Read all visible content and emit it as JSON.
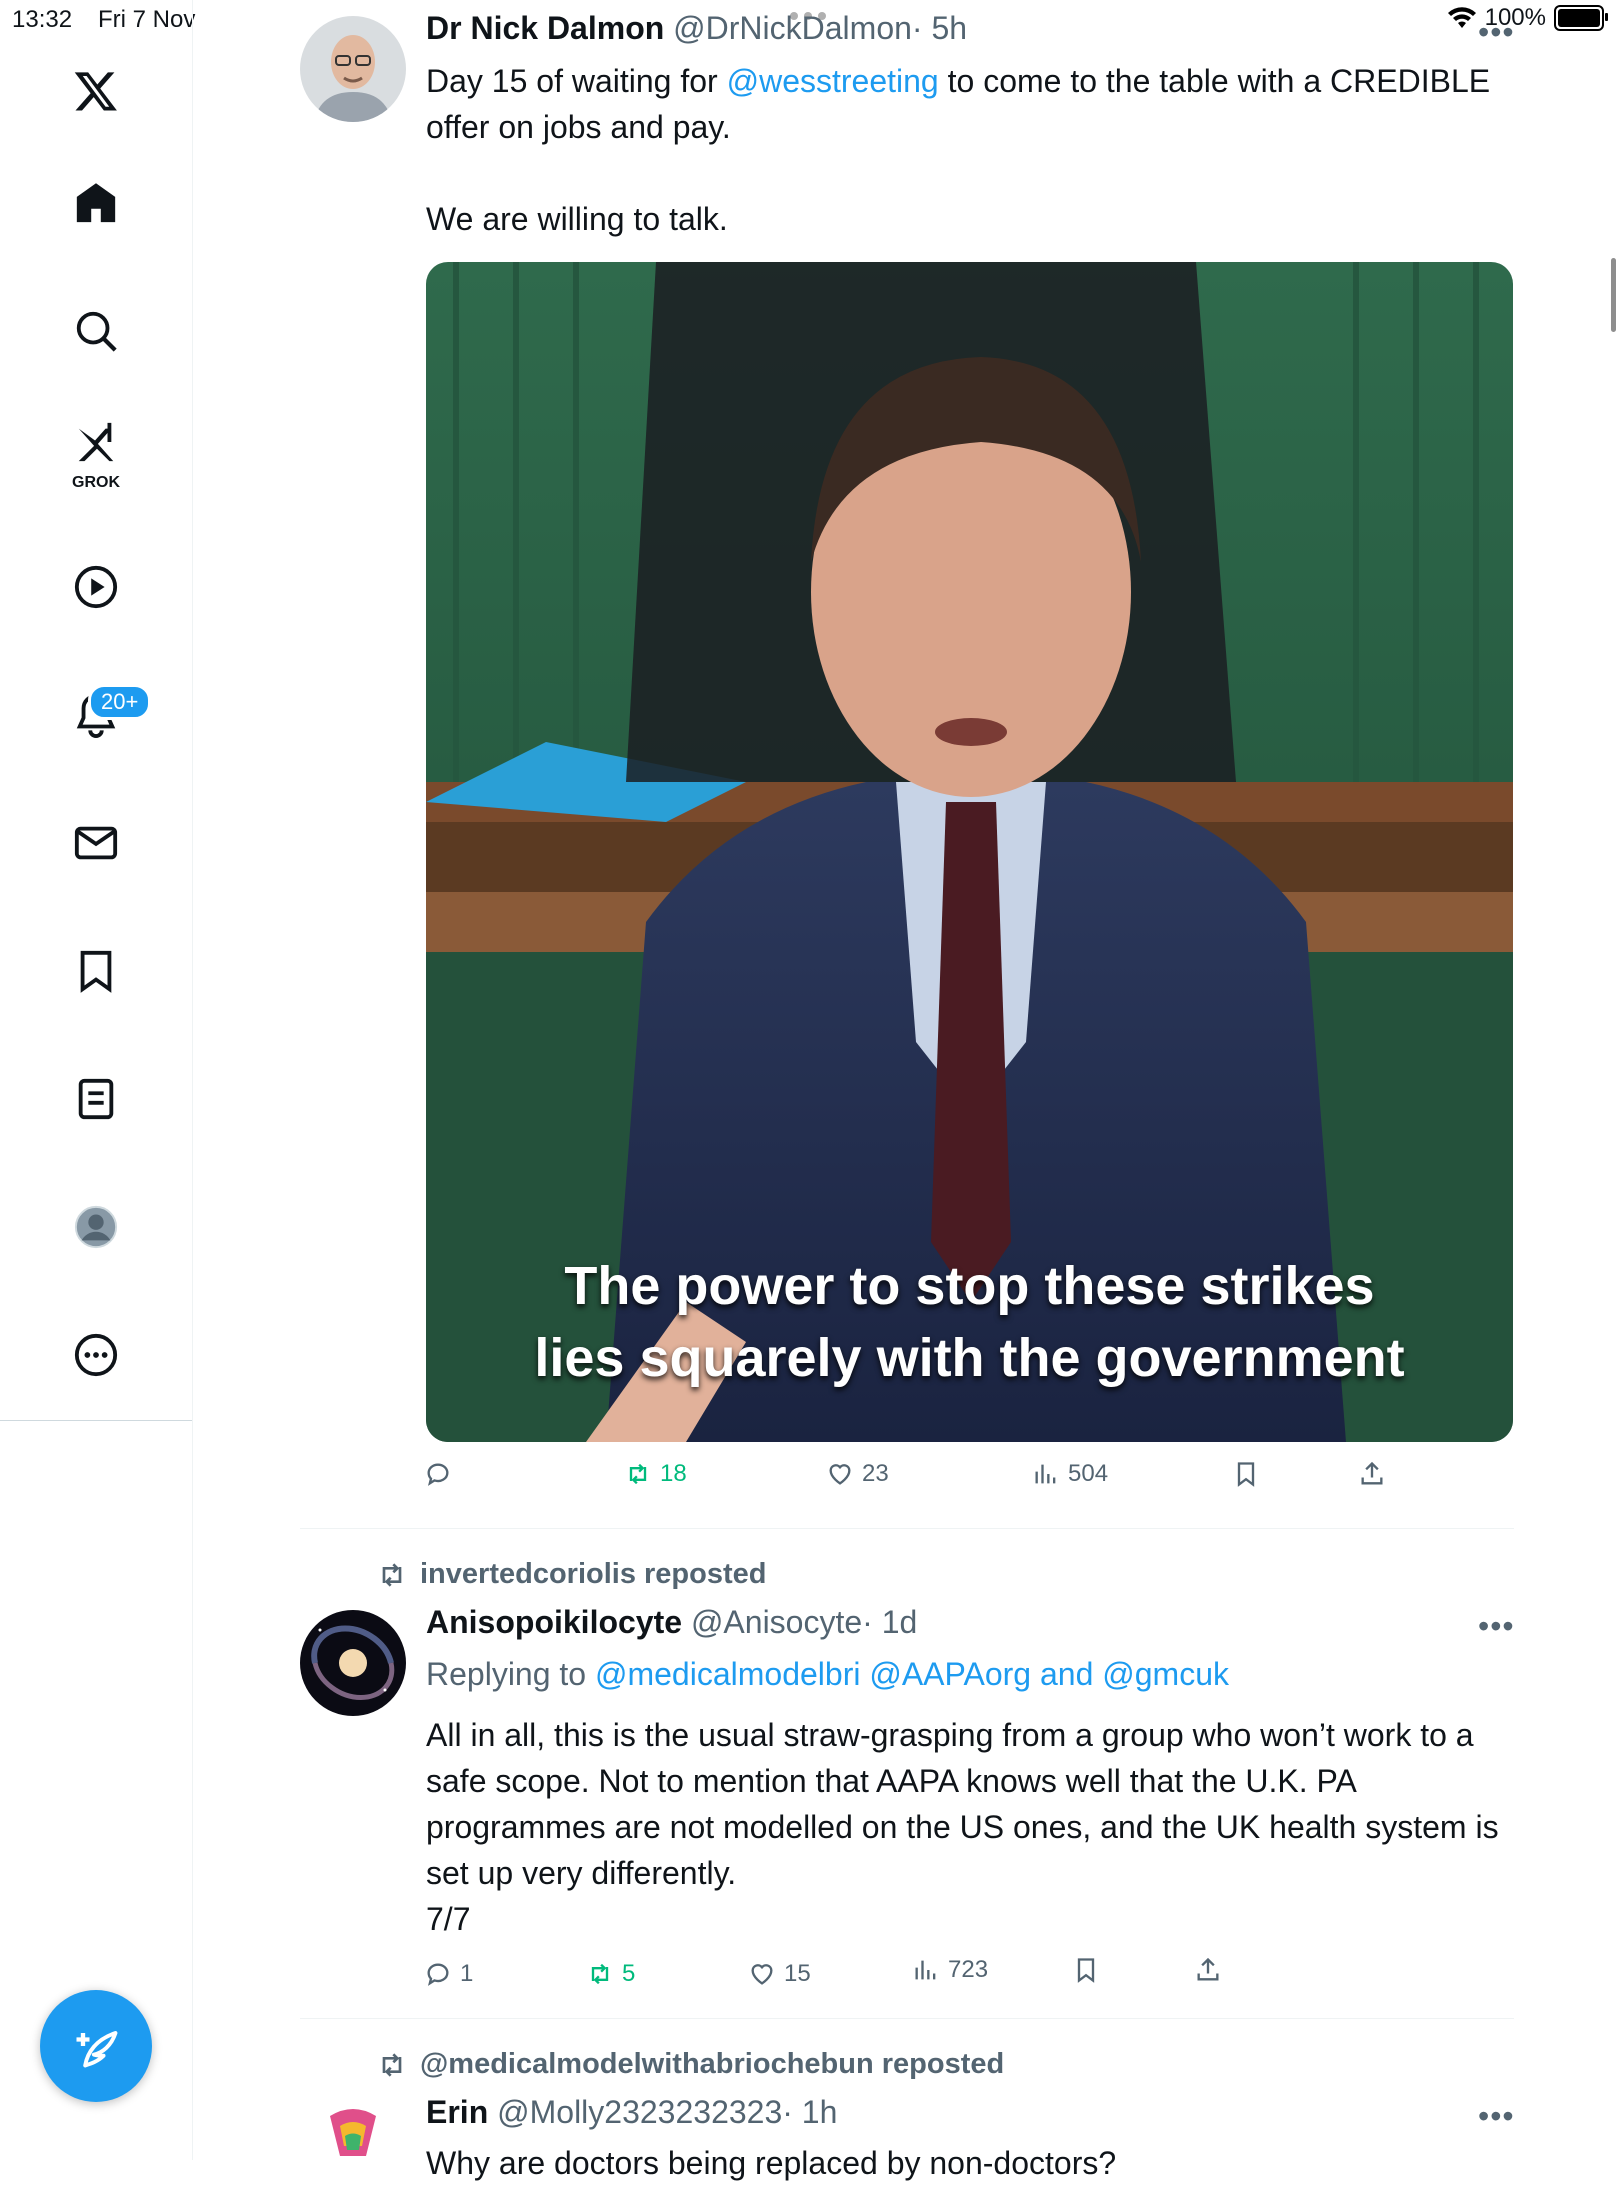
{
  "status_bar": {
    "time": "13:32",
    "date": "Fri 7 Nov",
    "battery": "100%"
  },
  "sidebar": {
    "grok_label": "GROK",
    "notifications_badge": "20+"
  },
  "tweets": [
    {
      "name": "Dr Nick Dalmon",
      "handle": "@DrNickDalmon",
      "time": "· 5h",
      "text_prefix": "Day 15 of waiting for ",
      "mention": "@wesstreeting",
      "text_suffix": " to come to the table with a CREDIBLE offer on jobs and pay.",
      "text_line2": "We are willing to talk.",
      "media_caption_line1": "The power to stop these strikes",
      "media_caption_line2": "lies squarely with the government",
      "reposts": "18",
      "likes": "23",
      "views": "504"
    },
    {
      "reposted_by": "invertedcoriolis reposted",
      "name": "Anisopoikilocyte",
      "handle": "@Anisocyte",
      "time": "· 1d",
      "replying_label": "Replying to ",
      "replying_mentions": "@medicalmodelbri @AAPAorg and @gmcuk",
      "text": "All in all, this is the usual straw-grasping from a group who won’t work to a safe scope. Not to mention that AAPA knows well that the U.K. PA programmes are not modelled on the US ones, and the UK health system is set up very differently.",
      "text_line2": "7/7",
      "replies": "1",
      "reposts": "5",
      "likes": "15",
      "views": "723"
    },
    {
      "reposted_by": "@medicalmodelwithabriochebun reposted",
      "name": "Erin",
      "handle": "@Molly2323232323",
      "time": "· 1h",
      "text": "Why are doctors being replaced by non-doctors?"
    }
  ],
  "colors": {
    "accent": "#1d9bf0",
    "repost_green": "#00ba7c",
    "muted": "#536471"
  },
  "icons": [
    "x-logo-icon",
    "home-icon",
    "search-icon",
    "grok-icon",
    "video-icon",
    "bell-icon",
    "mail-icon",
    "bookmark-icon",
    "lists-icon",
    "profile-icon",
    "more-circle-icon",
    "compose-icon",
    "reply-icon",
    "repost-icon",
    "like-icon",
    "views-icon",
    "share-icon"
  ]
}
